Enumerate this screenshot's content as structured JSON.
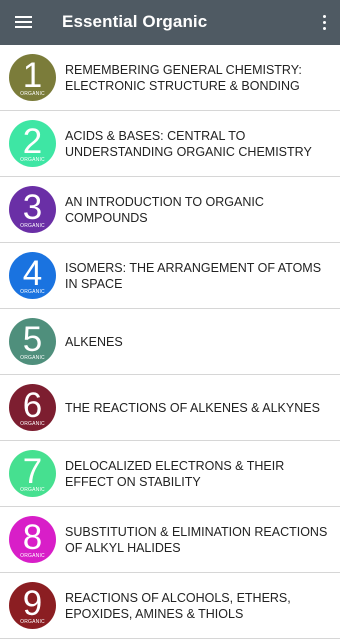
{
  "app_bar": {
    "title": "Essential Organic",
    "menu_icon": "hamburger-menu-icon",
    "overflow_icon": "more-vertical-icon"
  },
  "badge_subtitle": "ORGANIC",
  "chapters": [
    {
      "number": "1",
      "title": "REMEMBERING GENERAL CHEMISTRY: ELECTRONIC STRUCTURE & BONDING",
      "color": "#7b7c3a"
    },
    {
      "number": "2",
      "title": "ACIDS & BASES: CENTRAL TO UNDERSTANDING ORGANIC CHEMISTRY",
      "color": "#3ee6a4"
    },
    {
      "number": "3",
      "title": "AN INTRODUCTION TO ORGANIC COMPOUNDS",
      "color": "#6a2fa6"
    },
    {
      "number": "4",
      "title": "ISOMERS: THE ARRANGEMENT OF ATOMS IN SPACE",
      "color": "#1a73e0"
    },
    {
      "number": "5",
      "title": "ALKENES",
      "color": "#4f8f7c"
    },
    {
      "number": "6",
      "title": "THE REACTIONS OF ALKENES & ALKYNES",
      "color": "#7d1e30"
    },
    {
      "number": "7",
      "title": "DELOCALIZED ELECTRONS & THEIR EFFECT ON STABILITY",
      "color": "#46e090"
    },
    {
      "number": "8",
      "title": "SUBSTITUTION & ELIMINATION REACTIONS OF ALKYL HALIDES",
      "color": "#d81ec8"
    },
    {
      "number": "9",
      "title": "REACTIONS OF ALCOHOLS, ETHERS, EPOXIDES, AMINES & THIOLS",
      "color": "#8b1e22"
    }
  ]
}
